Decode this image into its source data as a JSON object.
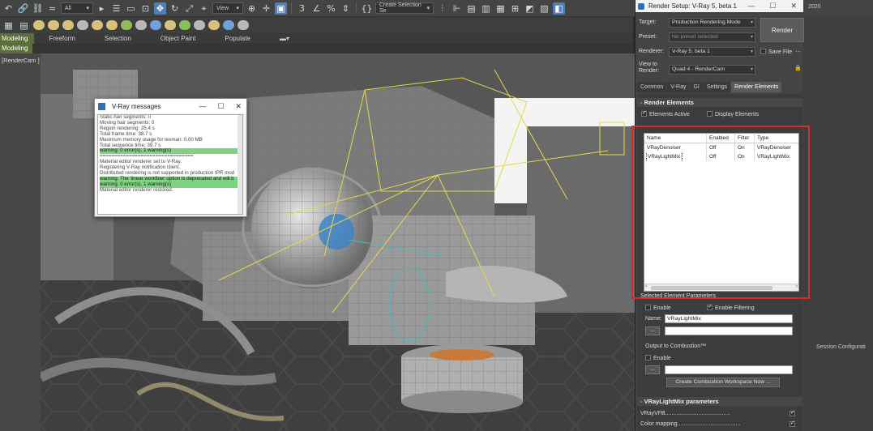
{
  "toolbar": {
    "selection_filter": "All",
    "ref_coord": "View",
    "create_selection_set": "Create Selection Se",
    "right_version": "2020"
  },
  "ribbon": {
    "tabs": [
      "Modeling",
      "Freeform",
      "Selection",
      "Object Paint",
      "Populate"
    ],
    "sub_label": "Modeling"
  },
  "viewport": {
    "label": "[RenderCam ] [Standard ] [Edged Faces ]"
  },
  "vray_messages": {
    "title": "V-Ray messages",
    "lines": [
      {
        "text": "Static hair segments: 0",
        "hl": false
      },
      {
        "text": "Moving hair segments: 0",
        "hl": false
      },
      {
        "text": "Region rendering: 35.4 s",
        "hl": false
      },
      {
        "text": "Total frame time: 38.7 s",
        "hl": false
      },
      {
        "text": "Maximum memory usage for texman: 0.00 MB",
        "hl": false
      },
      {
        "text": "Total sequence time: 39.7 s",
        "hl": false
      },
      {
        "text": "warning: 0 error(s), 1 warning(s)",
        "hl": true
      },
      {
        "text": "================================",
        "hl": false
      },
      {
        "text": "Material editor renderer set to V-Ray.",
        "hl": false
      },
      {
        "text": "Registering V-Ray notification client.",
        "hl": false
      },
      {
        "text": "Distributed rendering is not supported in production IPR mod",
        "hl": false
      },
      {
        "text": "warning: The 'linear workflow' option is deprecated and will b",
        "hl": true
      },
      {
        "text": "warning: 0 error(s), 1 warning(s)",
        "hl": true
      },
      {
        "text": "Material editor renderer restored.",
        "hl": false
      }
    ]
  },
  "render_setup": {
    "title": "Render Setup: V-Ray 5, beta 1",
    "target_label": "Target:",
    "target_value": "Production Rendering Mode",
    "preset_label": "Preset:",
    "preset_value": "No preset selected",
    "renderer_label": "Renderer:",
    "renderer_value": "V-Ray 5, beta 1",
    "save_file_label": "Save File",
    "view_label": "View to\nRender:",
    "view_value": "Quad 4 - RenderCam",
    "render_button": "Render",
    "tabs": [
      "Common",
      "V-Ray",
      "GI",
      "Settings",
      "Render Elements"
    ],
    "selected_tab": "Render Elements",
    "render_elements": {
      "rollout_title": "Render Elements",
      "elements_active": "Elements Active",
      "display_elements": "Display Elements",
      "columns": [
        "Name",
        "Enabled",
        "Filter",
        "Type"
      ],
      "rows": [
        {
          "name": "VRayDenoiser",
          "enabled": "Off",
          "filter": "On",
          "type": "VRayDenoiser"
        },
        {
          "name": "VRayLightMix",
          "enabled": "Off",
          "filter": "On",
          "type": "VRayLightMix"
        }
      ]
    },
    "selected_params": {
      "title": "Selected Element Parameters",
      "enable": "Enable",
      "enable_filtering": "Enable Filtering",
      "name_label": "Name:",
      "name_value": "VRayLightMix",
      "browse": "..."
    },
    "combustion": {
      "title": "Output to Combustion™",
      "enable": "Enable",
      "browse": "...",
      "create_button": "Create Combustion Workspace Now ..."
    },
    "lightmix": {
      "title": "VRayLightMix parameters",
      "vrayvfb": "VRayVFB.........................................",
      "color_mapping": "Color mapping........................................"
    }
  },
  "right_panel": {
    "session_config": "Session Configurati"
  }
}
